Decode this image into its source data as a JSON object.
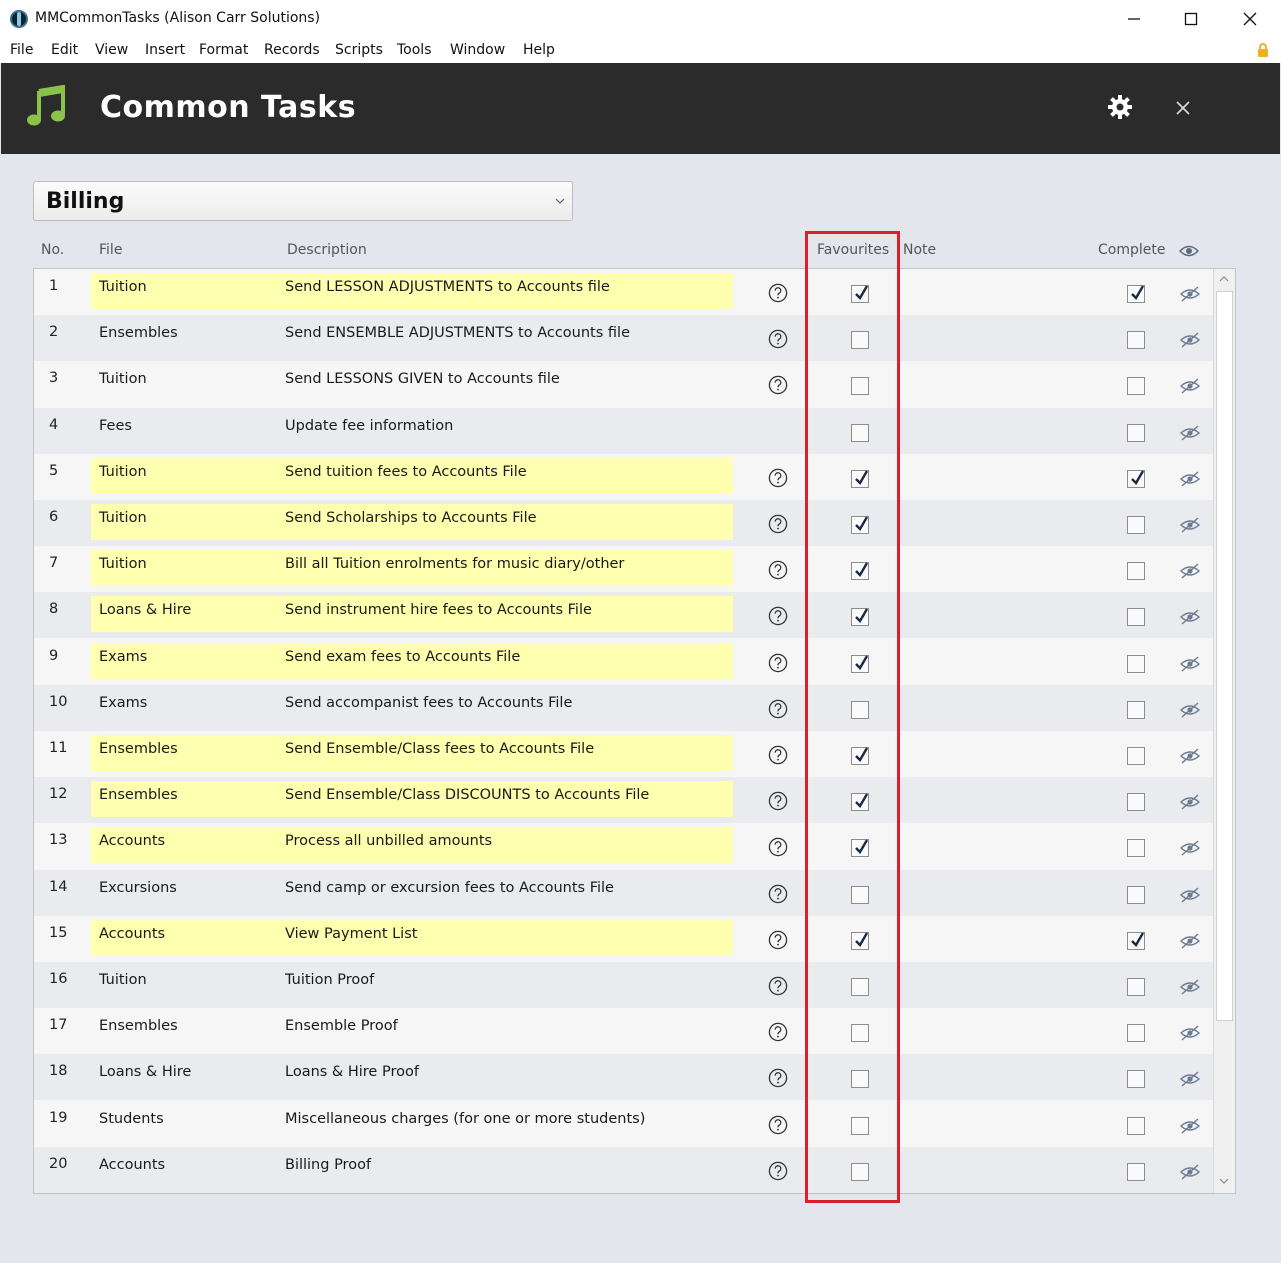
{
  "window": {
    "title": "MMCommonTasks (Alison Carr Solutions)",
    "controls": [
      "minimize",
      "maximize",
      "close"
    ]
  },
  "menu": [
    "File",
    "Edit",
    "View",
    "Insert",
    "Format",
    "Records",
    "Scripts",
    "Tools",
    "Window",
    "Help"
  ],
  "header": {
    "title": "Common Tasks",
    "icon": "music-note-icon",
    "accent": "#8bc34a",
    "background": "#2b2b2b"
  },
  "category": {
    "value": "Billing"
  },
  "columns": {
    "no": "No.",
    "file": "File",
    "description": "Description",
    "favourites": "Favourites",
    "note": "Note",
    "complete": "Complete"
  },
  "colors": {
    "highlight_row": "#ffffb0",
    "annotation": "#d9202b"
  },
  "rows": [
    {
      "no": "1",
      "file": "Tuition",
      "description": "Send LESSON ADJUSTMENTS to Accounts file",
      "help": true,
      "favourite": true,
      "complete": true
    },
    {
      "no": "2",
      "file": "Ensembles",
      "description": "Send ENSEMBLE ADJUSTMENTS to Accounts file",
      "help": true,
      "favourite": false,
      "complete": false
    },
    {
      "no": "3",
      "file": "Tuition",
      "description": "Send LESSONS GIVEN to Accounts file",
      "help": true,
      "favourite": false,
      "complete": false
    },
    {
      "no": "4",
      "file": "Fees",
      "description": "Update fee information",
      "help": false,
      "favourite": false,
      "complete": false
    },
    {
      "no": "5",
      "file": "Tuition",
      "description": "Send tuition fees to Accounts File",
      "help": true,
      "favourite": true,
      "complete": true
    },
    {
      "no": "6",
      "file": "Tuition",
      "description": "Send Scholarships to Accounts File",
      "help": true,
      "favourite": true,
      "complete": false
    },
    {
      "no": "7",
      "file": "Tuition",
      "description": "Bill all Tuition enrolments for music diary/other",
      "help": true,
      "favourite": true,
      "complete": false
    },
    {
      "no": "8",
      "file": "Loans & Hire",
      "description": "Send instrument hire fees to Accounts File",
      "help": true,
      "favourite": true,
      "complete": false
    },
    {
      "no": "9",
      "file": "Exams",
      "description": "Send exam fees to Accounts File",
      "help": true,
      "favourite": true,
      "complete": false
    },
    {
      "no": "10",
      "file": "Exams",
      "description": "Send accompanist fees to Accounts File",
      "help": true,
      "favourite": false,
      "complete": false
    },
    {
      "no": "11",
      "file": "Ensembles",
      "description": "Send Ensemble/Class fees to Accounts File",
      "help": true,
      "favourite": true,
      "complete": false
    },
    {
      "no": "12",
      "file": "Ensembles",
      "description": "Send Ensemble/Class DISCOUNTS to Accounts File",
      "help": true,
      "favourite": true,
      "complete": false
    },
    {
      "no": "13",
      "file": "Accounts",
      "description": "Process all unbilled amounts",
      "help": true,
      "favourite": true,
      "complete": false
    },
    {
      "no": "14",
      "file": "Excursions",
      "description": "Send camp or excursion fees to Accounts File",
      "help": true,
      "favourite": false,
      "complete": false
    },
    {
      "no": "15",
      "file": "Accounts",
      "description": "View Payment List",
      "help": true,
      "favourite": true,
      "complete": true
    },
    {
      "no": "16",
      "file": "Tuition",
      "description": "Tuition Proof",
      "help": true,
      "favourite": false,
      "complete": false
    },
    {
      "no": "17",
      "file": "Ensembles",
      "description": "Ensemble Proof",
      "help": true,
      "favourite": false,
      "complete": false
    },
    {
      "no": "18",
      "file": "Loans & Hire",
      "description": "Loans & Hire Proof",
      "help": true,
      "favourite": false,
      "complete": false
    },
    {
      "no": "19",
      "file": "Students",
      "description": "Miscellaneous charges (for one or more students)",
      "help": true,
      "favourite": false,
      "complete": false
    },
    {
      "no": "20",
      "file": "Accounts",
      "description": "Billing Proof",
      "help": true,
      "favourite": false,
      "complete": false
    }
  ]
}
